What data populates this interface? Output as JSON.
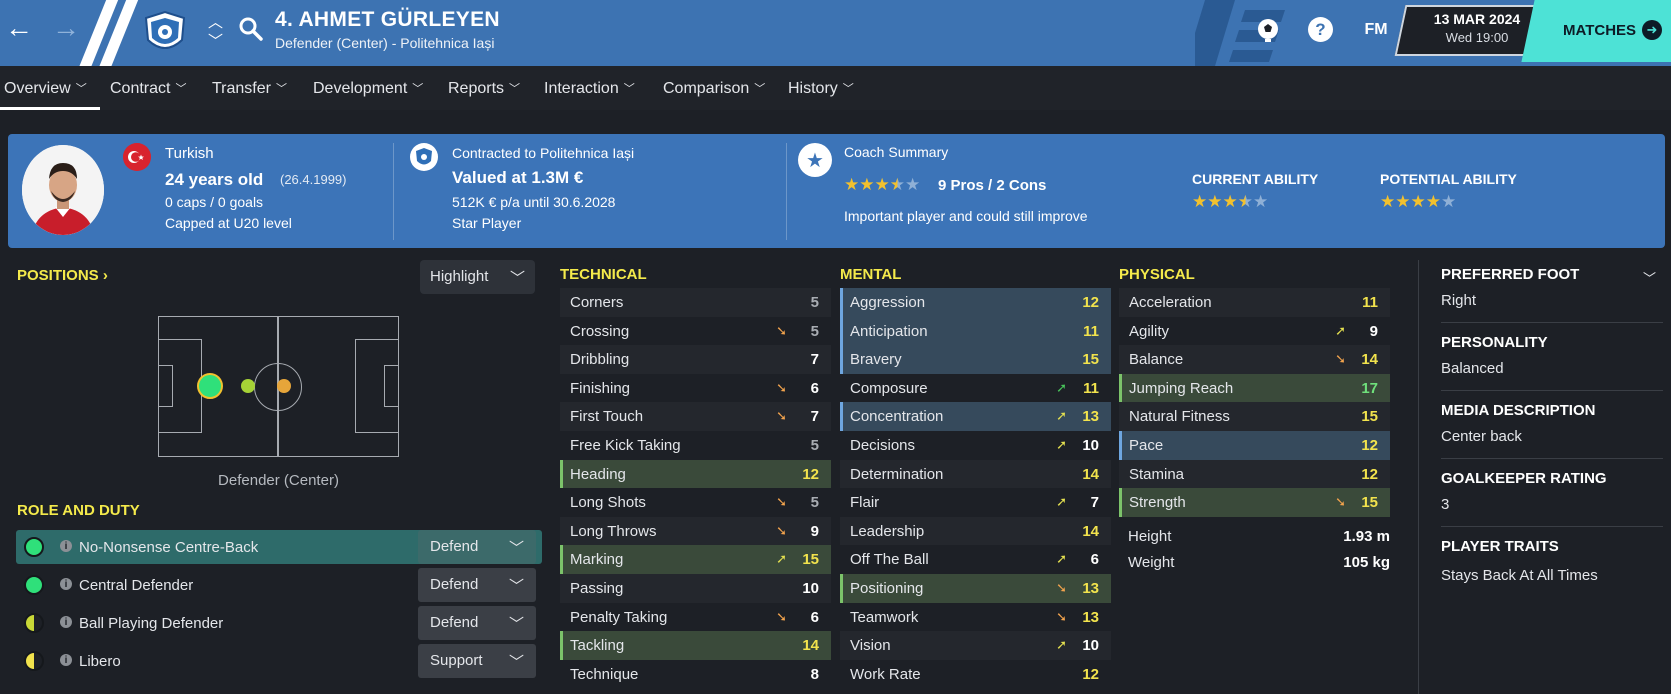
{
  "header": {
    "title": "4. AHMET GÜRLEYEN",
    "subtitle": "Defender (Center) - Politehnica Iași",
    "date": "13 MAR 2024",
    "time": "Wed 19:00",
    "matches_label": "MATCHES",
    "fm_label": "FM",
    "help_label": "?"
  },
  "tabs": [
    {
      "label": "Overview"
    },
    {
      "label": "Contract"
    },
    {
      "label": "Transfer"
    },
    {
      "label": "Development"
    },
    {
      "label": "Reports"
    },
    {
      "label": "Interaction"
    },
    {
      "label": "Comparison"
    },
    {
      "label": "History"
    }
  ],
  "summary": {
    "nationality": "Turkish",
    "age": "24 years old",
    "dob": "(26.4.1999)",
    "caps": "0 caps / 0 goals",
    "capped_level": "Capped at U20 level",
    "contract": "Contracted to Politehnica Iași",
    "value": "Valued at 1.3M €",
    "wage": "512K € p/a until 30.6.2028",
    "status": "Star Player",
    "coach_title": "Coach Summary",
    "pros_cons": "9 Pros / 2 Cons",
    "coach_note": "Important player and could still improve",
    "current_ability_label": "CURRENT ABILITY",
    "potential_ability_label": "POTENTIAL ABILITY",
    "coach_stars": 3.5,
    "current_stars": 3.5,
    "potential_stars": 4
  },
  "positions": {
    "heading": "POSITIONS",
    "highlight_label": "Highlight",
    "position_label": "Defender (Center)"
  },
  "roles": {
    "heading": "ROLE AND DUTY",
    "items": [
      {
        "name": "No-Nonsense Centre-Back",
        "duty": "Defend",
        "suitability": "full-green"
      },
      {
        "name": "Central Defender",
        "duty": "Defend",
        "suitability": "full-green"
      },
      {
        "name": "Ball Playing Defender",
        "duty": "Defend",
        "suitability": "half-yellow"
      },
      {
        "name": "Libero",
        "duty": "Support",
        "suitability": "half-yellow"
      }
    ]
  },
  "technical": {
    "heading": "TECHNICAL",
    "items": [
      {
        "name": "Corners",
        "value": "5",
        "arrow": "",
        "hl": ""
      },
      {
        "name": "Crossing",
        "value": "5",
        "arrow": "up",
        "hl": ""
      },
      {
        "name": "Dribbling",
        "value": "7",
        "arrow": "",
        "hl": ""
      },
      {
        "name": "Finishing",
        "value": "6",
        "arrow": "up",
        "hl": ""
      },
      {
        "name": "First Touch",
        "value": "7",
        "arrow": "up",
        "hl": ""
      },
      {
        "name": "Free Kick Taking",
        "value": "5",
        "arrow": "",
        "hl": ""
      },
      {
        "name": "Heading",
        "value": "12",
        "arrow": "",
        "hl": "green"
      },
      {
        "name": "Long Shots",
        "value": "5",
        "arrow": "up",
        "hl": ""
      },
      {
        "name": "Long Throws",
        "value": "9",
        "arrow": "up",
        "hl": ""
      },
      {
        "name": "Marking",
        "value": "15",
        "arrow": "down",
        "hl": "green"
      },
      {
        "name": "Passing",
        "value": "10",
        "arrow": "",
        "hl": ""
      },
      {
        "name": "Penalty Taking",
        "value": "6",
        "arrow": "up",
        "hl": ""
      },
      {
        "name": "Tackling",
        "value": "14",
        "arrow": "",
        "hl": "green"
      },
      {
        "name": "Technique",
        "value": "8",
        "arrow": "",
        "hl": ""
      }
    ]
  },
  "mental": {
    "heading": "MENTAL",
    "items": [
      {
        "name": "Aggression",
        "value": "12",
        "arrow": "",
        "hl": "blue"
      },
      {
        "name": "Anticipation",
        "value": "11",
        "arrow": "",
        "hl": "blue"
      },
      {
        "name": "Bravery",
        "value": "15",
        "arrow": "",
        "hl": "blue"
      },
      {
        "name": "Composure",
        "value": "11",
        "arrow": "green",
        "hl": ""
      },
      {
        "name": "Concentration",
        "value": "13",
        "arrow": "down",
        "hl": "blue"
      },
      {
        "name": "Decisions",
        "value": "10",
        "arrow": "down",
        "hl": ""
      },
      {
        "name": "Determination",
        "value": "14",
        "arrow": "",
        "hl": ""
      },
      {
        "name": "Flair",
        "value": "7",
        "arrow": "down",
        "hl": ""
      },
      {
        "name": "Leadership",
        "value": "14",
        "arrow": "",
        "hl": ""
      },
      {
        "name": "Off The Ball",
        "value": "6",
        "arrow": "down",
        "hl": ""
      },
      {
        "name": "Positioning",
        "value": "13",
        "arrow": "up",
        "hl": "green"
      },
      {
        "name": "Teamwork",
        "value": "13",
        "arrow": "up",
        "hl": ""
      },
      {
        "name": "Vision",
        "value": "10",
        "arrow": "down",
        "hl": ""
      },
      {
        "name": "Work Rate",
        "value": "12",
        "arrow": "",
        "hl": ""
      }
    ]
  },
  "physical": {
    "heading": "PHYSICAL",
    "items": [
      {
        "name": "Acceleration",
        "value": "11",
        "arrow": "",
        "hl": ""
      },
      {
        "name": "Agility",
        "value": "9",
        "arrow": "down",
        "hl": ""
      },
      {
        "name": "Balance",
        "value": "14",
        "arrow": "up",
        "hl": ""
      },
      {
        "name": "Jumping Reach",
        "value": "17",
        "arrow": "",
        "hl": "green"
      },
      {
        "name": "Natural Fitness",
        "value": "15",
        "arrow": "",
        "hl": ""
      },
      {
        "name": "Pace",
        "value": "12",
        "arrow": "",
        "hl": "blue"
      },
      {
        "name": "Stamina",
        "value": "12",
        "arrow": "",
        "hl": ""
      },
      {
        "name": "Strength",
        "value": "15",
        "arrow": "up",
        "hl": "green"
      }
    ],
    "height_label": "Height",
    "height_value": "1.93 m",
    "weight_label": "Weight",
    "weight_value": "105 kg"
  },
  "info": {
    "preferred_foot_label": "PREFERRED FOOT",
    "preferred_foot": "Right",
    "personality_label": "PERSONALITY",
    "personality": "Balanced",
    "media_label": "MEDIA DESCRIPTION",
    "media": "Center back",
    "gk_label": "GOALKEEPER RATING",
    "gk": "3",
    "traits_label": "PLAYER TRAITS",
    "traits": "Stays Back At All Times"
  },
  "colors": {
    "topbar": "#3d73b2",
    "summary": "#3c74b8",
    "accent_yellow": "#f4ea4b",
    "matches": "#4de2d6"
  }
}
